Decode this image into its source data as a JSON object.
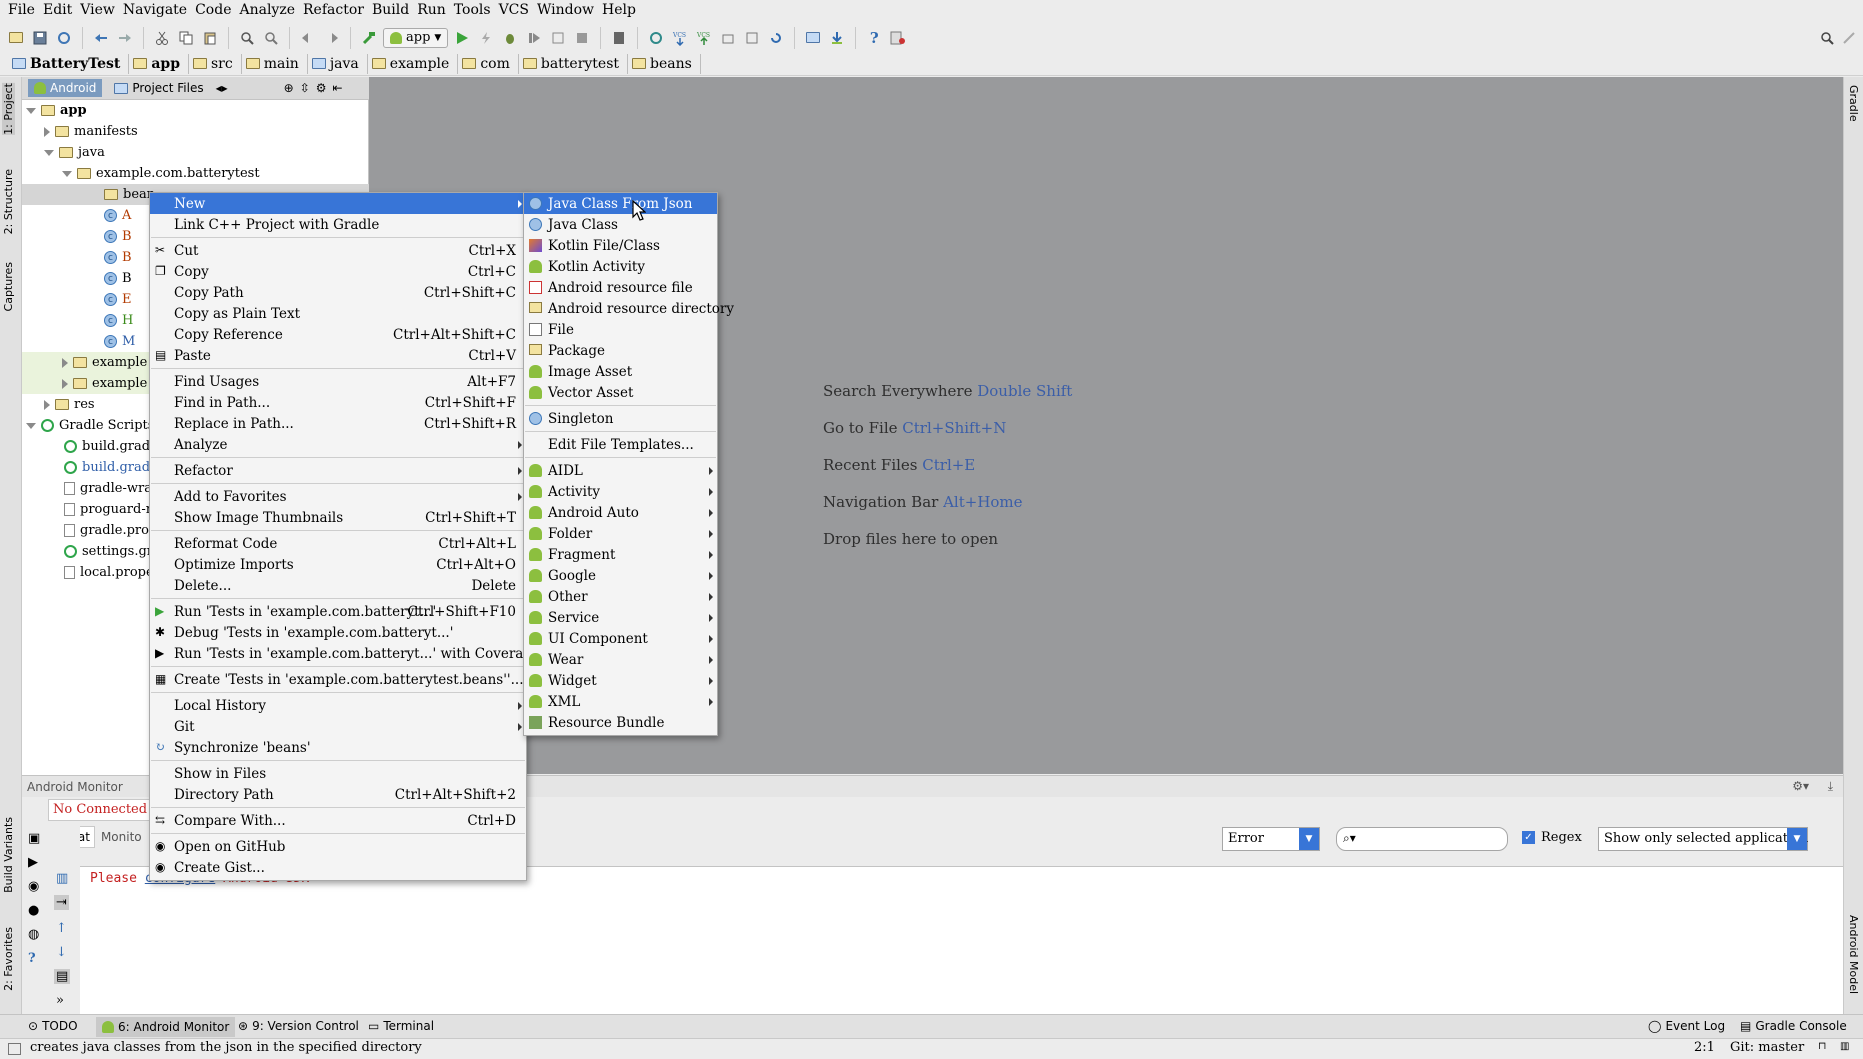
{
  "menubar": [
    "File",
    "Edit",
    "View",
    "Navigate",
    "Code",
    "Analyze",
    "Refactor",
    "Build",
    "Run",
    "Tools",
    "VCS",
    "Window",
    "Help"
  ],
  "toolbar": {
    "run_config": "app"
  },
  "breadcrumbs": [
    "BatteryTest",
    "app",
    "src",
    "main",
    "java",
    "example",
    "com",
    "batterytest",
    "beans"
  ],
  "side_tabs": {
    "project": "1: Project",
    "structure": "2: Structure",
    "captures": "Captures",
    "build_variants": "Build Variants",
    "favorites": "2: Favorites",
    "gradle": "Gradle",
    "android_model": "Android Model"
  },
  "project_panel": {
    "tab_android": "Android",
    "tab_project_files": "Project Files"
  },
  "tree": [
    {
      "label": "app",
      "bold": true
    },
    {
      "label": "manifests"
    },
    {
      "label": "java"
    },
    {
      "label": "example.com.batterytest"
    },
    {
      "label": "bean"
    },
    {
      "label": "A"
    },
    {
      "label": "B"
    },
    {
      "label": "B"
    },
    {
      "label": "B"
    },
    {
      "label": "E"
    },
    {
      "label": "H"
    },
    {
      "label": "M"
    },
    {
      "label": "example"
    },
    {
      "label": "example"
    },
    {
      "label": "res"
    },
    {
      "label": "Gradle Scripts"
    },
    {
      "label": "build.gradle"
    },
    {
      "label": "build.gradle"
    },
    {
      "label": "gradle-wrap"
    },
    {
      "label": "proguard-ru"
    },
    {
      "label": "gradle.prop"
    },
    {
      "label": "settings.gra"
    },
    {
      "label": "local.proper"
    }
  ],
  "editor_hints": [
    {
      "text": "Search Everywhere",
      "key": "Double Shift"
    },
    {
      "text": "Go to File",
      "key": "Ctrl+Shift+N"
    },
    {
      "text": "Recent Files",
      "key": "Ctrl+E"
    },
    {
      "text": "Navigation Bar",
      "key": "Alt+Home"
    },
    {
      "text": "Drop files here to open",
      "key": ""
    }
  ],
  "context_menu": [
    {
      "label": "New",
      "submenu": true,
      "highlighted": true
    },
    {
      "label": "Link C++ Project with Gradle"
    },
    {
      "label": "Cut",
      "shortcut": "Ctrl+X"
    },
    {
      "label": "Copy",
      "shortcut": "Ctrl+C"
    },
    {
      "label": "Copy Path",
      "shortcut": "Ctrl+Shift+C"
    },
    {
      "label": "Copy as Plain Text"
    },
    {
      "label": "Copy Reference",
      "shortcut": "Ctrl+Alt+Shift+C"
    },
    {
      "label": "Paste",
      "shortcut": "Ctrl+V"
    },
    {
      "label": "Find Usages",
      "shortcut": "Alt+F7"
    },
    {
      "label": "Find in Path...",
      "shortcut": "Ctrl+Shift+F"
    },
    {
      "label": "Replace in Path...",
      "shortcut": "Ctrl+Shift+R"
    },
    {
      "label": "Analyze",
      "submenu": true
    },
    {
      "label": "Refactor",
      "submenu": true
    },
    {
      "label": "Add to Favorites",
      "submenu": true
    },
    {
      "label": "Show Image Thumbnails",
      "shortcut": "Ctrl+Shift+T"
    },
    {
      "label": "Reformat Code",
      "shortcut": "Ctrl+Alt+L"
    },
    {
      "label": "Optimize Imports",
      "shortcut": "Ctrl+Alt+O"
    },
    {
      "label": "Delete...",
      "shortcut": "Delete"
    },
    {
      "label": "Run 'Tests in 'example.com.batteryt...'",
      "shortcut": "Ctrl+Shift+F10"
    },
    {
      "label": "Debug 'Tests in 'example.com.batteryt...'"
    },
    {
      "label": "Run 'Tests in 'example.com.batteryt...' with Coverage"
    },
    {
      "label": "Create 'Tests in 'example.com.batterytest.beans''..."
    },
    {
      "label": "Local History",
      "submenu": true
    },
    {
      "label": "Git",
      "submenu": true
    },
    {
      "label": "Synchronize 'beans'"
    },
    {
      "label": "Show in Files"
    },
    {
      "label": "Directory Path",
      "shortcut": "Ctrl+Alt+Shift+2"
    },
    {
      "label": "Compare With...",
      "shortcut": "Ctrl+D"
    },
    {
      "label": "Open on GitHub"
    },
    {
      "label": "Create Gist..."
    }
  ],
  "new_submenu": [
    {
      "label": "Java Class From Json",
      "highlighted": true
    },
    {
      "label": "Java Class"
    },
    {
      "label": "Kotlin File/Class"
    },
    {
      "label": "Kotlin Activity"
    },
    {
      "label": "Android resource file"
    },
    {
      "label": "Android resource directory"
    },
    {
      "label": "File"
    },
    {
      "label": "Package"
    },
    {
      "label": "Image Asset"
    },
    {
      "label": "Vector Asset"
    },
    {
      "label": "Singleton"
    },
    {
      "label": "Edit File Templates..."
    },
    {
      "label": "AIDL",
      "submenu": true
    },
    {
      "label": "Activity",
      "submenu": true
    },
    {
      "label": "Android Auto",
      "submenu": true
    },
    {
      "label": "Folder",
      "submenu": true
    },
    {
      "label": "Fragment",
      "submenu": true
    },
    {
      "label": "Google",
      "submenu": true
    },
    {
      "label": "Other",
      "submenu": true
    },
    {
      "label": "Service",
      "submenu": true
    },
    {
      "label": "UI Component",
      "submenu": true
    },
    {
      "label": "Wear",
      "submenu": true
    },
    {
      "label": "Widget",
      "submenu": true
    },
    {
      "label": "XML",
      "submenu": true
    },
    {
      "label": "Resource Bundle"
    }
  ],
  "monitor": {
    "title": "Android Monitor",
    "no_device": "No Connected D",
    "tab_logcat": "logcat",
    "tab_monitors": "Monito",
    "level": "Error",
    "regex_label": "Regex",
    "filter": "Show only selected application",
    "log_prefix": "Please",
    "log_link": "configure",
    "log_suffix": "Android SDK"
  },
  "bottom_tabs": {
    "todo": "TODO",
    "monitor": "6: Android Monitor",
    "vcs": "9: Version Control",
    "terminal": "Terminal",
    "event_log": "Event Log",
    "gradle_console": "Gradle Console"
  },
  "status": {
    "message": "creates java classes from the json in the specified directory",
    "position": "2:1",
    "git": "Git: master"
  }
}
